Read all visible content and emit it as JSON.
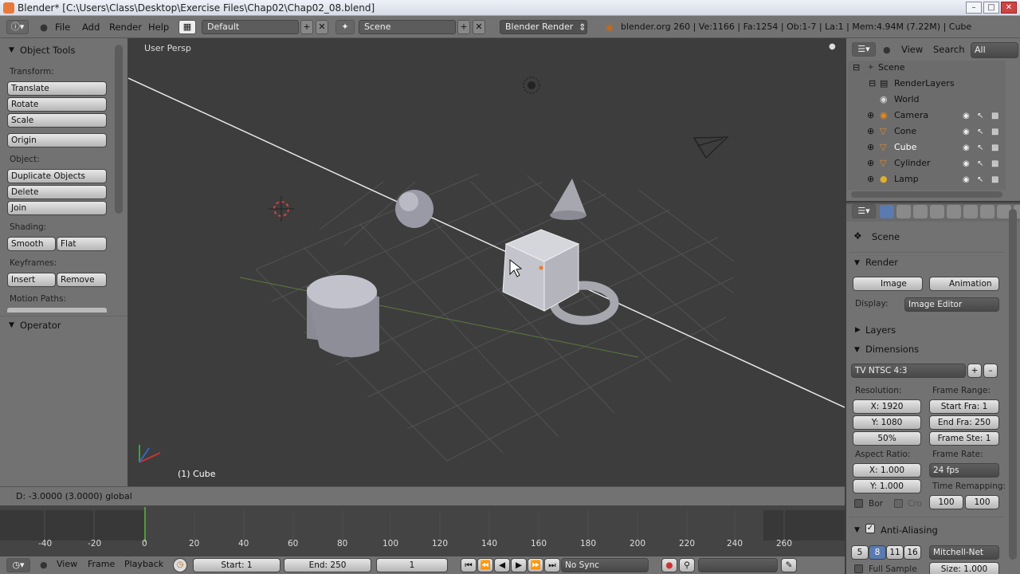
{
  "window": {
    "title": "Blender* [C:\\Users\\Class\\Desktop\\Exercise Files\\Chap02\\Chap02_08.blend]"
  },
  "info_header": {
    "menus": [
      "File",
      "Add",
      "Render",
      "Help"
    ],
    "screen_layout": "Default",
    "scene": "Scene",
    "render_engine": "Blender Render",
    "stats": "blender.org 260 | Ve:1166 | Fa:1254 | Ob:1-7 | La:1 | Mem:4.94M (7.22M) | Cube"
  },
  "tool_shelf": {
    "title": "Object Tools",
    "transform_label": "Transform:",
    "translate": "Translate",
    "rotate": "Rotate",
    "scale": "Scale",
    "origin": "Origin",
    "object_label": "Object:",
    "duplicate": "Duplicate Objects",
    "delete": "Delete",
    "join": "Join",
    "shading_label": "Shading:",
    "smooth": "Smooth",
    "flat": "Flat",
    "keyframes_label": "Keyframes:",
    "insert": "Insert",
    "remove": "Remove",
    "motion_paths_label": "Motion Paths:",
    "operator_title": "Operator"
  },
  "viewport": {
    "view_name": "User Persp",
    "object_label": "(1) Cube",
    "status": "D: -3.0000 (3.0000) global"
  },
  "outliner": {
    "view": "View",
    "search": "Search",
    "all_scenes": "All Scenes",
    "items": [
      {
        "label": "Scene"
      },
      {
        "label": "RenderLayers"
      },
      {
        "label": "World"
      },
      {
        "label": "Camera"
      },
      {
        "label": "Cone"
      },
      {
        "label": "Cube"
      },
      {
        "label": "Cylinder"
      },
      {
        "label": "Lamp"
      }
    ]
  },
  "properties": {
    "context": "Scene",
    "render_section": "Render",
    "image_button": "Image",
    "animation_button": "Animation",
    "display_label": "Display:",
    "display_value": "Image Editor",
    "layers_section": "Layers",
    "dimensions_section": "Dimensions",
    "preset": "TV NTSC 4:3",
    "resolution_label": "Resolution:",
    "res_x": "X: 1920",
    "res_y": "Y: 1080",
    "res_pct": "50%",
    "frame_range_label": "Frame Range:",
    "start_frame": "Start Fra: 1",
    "end_frame": "End Fra: 250",
    "frame_step": "Frame Ste: 1",
    "aspect_label": "Aspect Ratio:",
    "aspect_x": "X: 1.000",
    "aspect_y": "Y: 1.000",
    "frame_rate_label": "Frame Rate:",
    "fps": "24 fps",
    "time_remap_label": "Time Remapping:",
    "remap_old": "100",
    "remap_new": "100",
    "border": "Bor",
    "crop": "Cro",
    "aa_section": "Anti-Aliasing",
    "aa_samples": [
      "5",
      "8",
      "11",
      "16"
    ],
    "aa_filter": "Mitchell-Net",
    "full_sample": "Full Sample",
    "filter_size": "Size: 1.000"
  },
  "timeline": {
    "ticks": [
      "-40",
      "-20",
      "0",
      "20",
      "40",
      "60",
      "80",
      "100",
      "120",
      "140",
      "160",
      "180",
      "200",
      "220",
      "240",
      "260"
    ],
    "view": "View",
    "frame": "Frame",
    "playback": "Playback",
    "start": "Start: 1",
    "end": "End: 250",
    "current": "1",
    "sync": "No Sync"
  }
}
